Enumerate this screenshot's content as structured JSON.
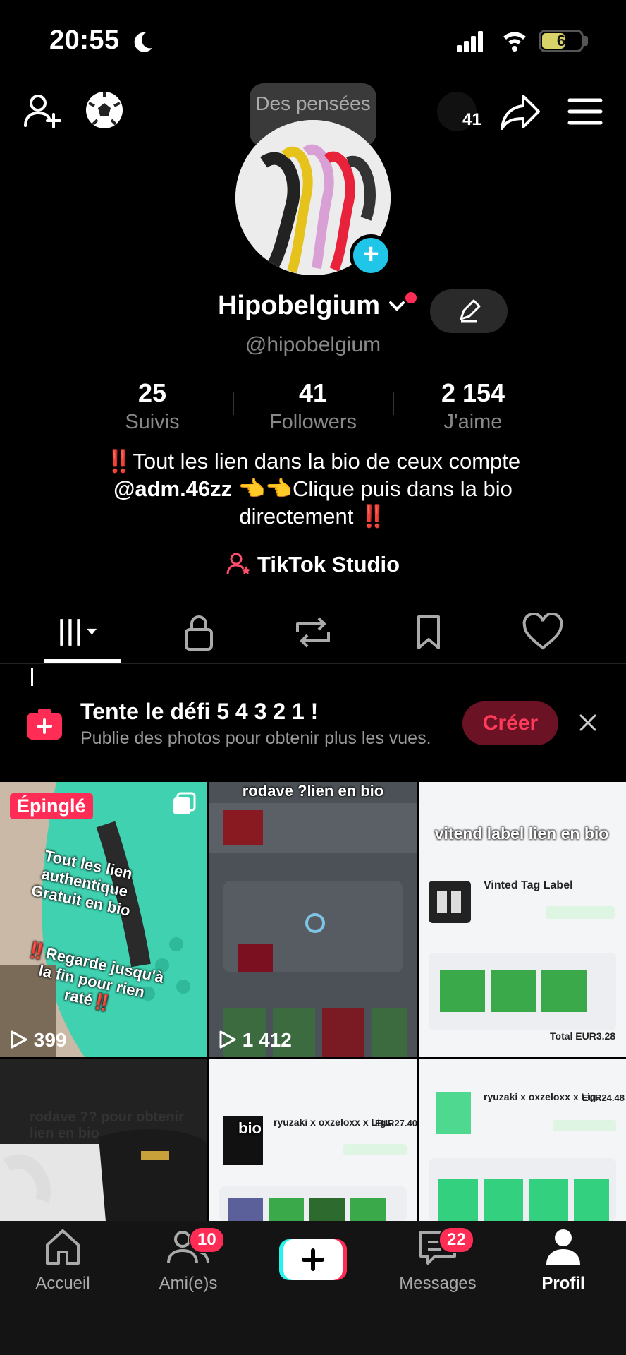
{
  "status_bar": {
    "time": "20:55",
    "battery": "6"
  },
  "header": {
    "thought_bubble": "Des pensées ?",
    "notif_count": "41"
  },
  "profile": {
    "display_name": "Hipobelgium",
    "handle": "@hipobelgium",
    "stats": [
      {
        "value": "25",
        "label": "Suivis"
      },
      {
        "value": "41",
        "label": "Followers"
      },
      {
        "value": "2 154",
        "label": "J'aime"
      }
    ],
    "bio_line1": "‼️Tout les lien dans la bio de ceux compte",
    "bio_line2_handle": "@adm.46zz",
    "bio_line2_rest": " 👈👈Clique puis dans la bio",
    "bio_line3": "directement ‼️",
    "studio_label": "TikTok Studio"
  },
  "challenge": {
    "title": "Tente le défi 5 4 3 2 1 !",
    "subtitle": "Publie des photos pour obtenir plus les vues.",
    "button": "Créer"
  },
  "videos": [
    {
      "pinned_label": "Épinglé",
      "overlay_top": "Tout les lien authentique Gratuit en bio",
      "overlay_bottom": "‼️Regarde jusqu'à la fin pour rien raté‼️",
      "views": "399"
    },
    {
      "overlay_top": "rodave ?lien en bio",
      "views": "1 412"
    },
    {
      "overlay_top": "vitend label lien en bio",
      "order_label": "Vinted Tag Label",
      "total": "Total EUR3.28"
    },
    {
      "overlay_top": "rodave ?? pour obtenir lien en bio"
    },
    {
      "overlay_top": "bio",
      "item": "ryuzaki x oxzeloxx x Lig...",
      "price": "EUR27.40"
    },
    {
      "item": "ryuzaki x oxzeloxx x Lig...",
      "price": "EUR24.48"
    }
  ],
  "nav": {
    "home": "Accueil",
    "friends": "Ami(e)s",
    "friends_badge": "10",
    "messages": "Messages",
    "messages_badge": "22",
    "profile": "Profil"
  },
  "colors": {
    "accent": "#ff2d55",
    "cyan": "#20c6e8",
    "bg": "#000000"
  }
}
